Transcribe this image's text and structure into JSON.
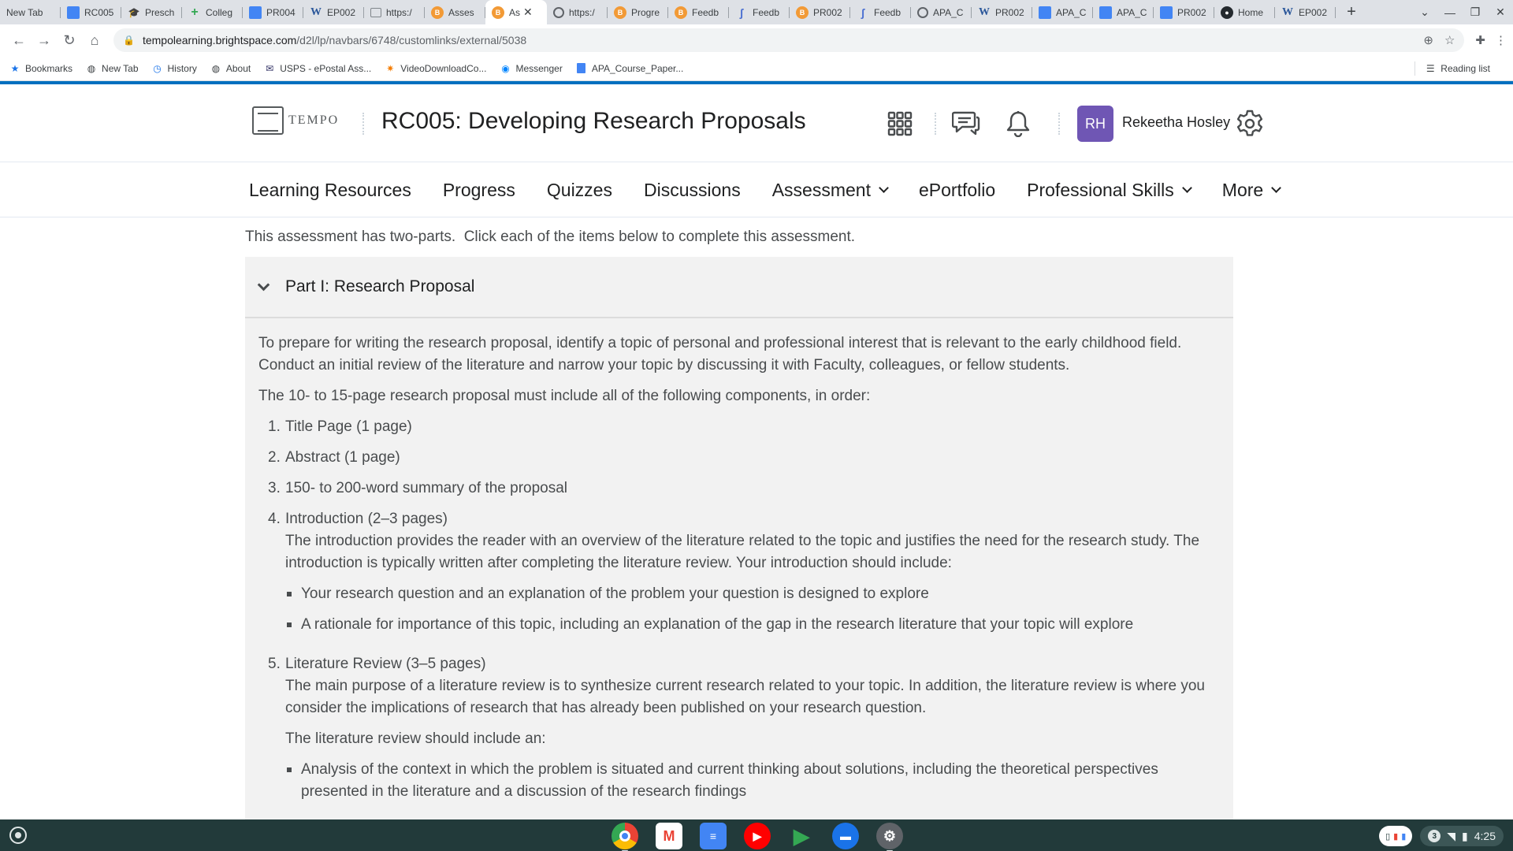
{
  "browser": {
    "tabs": [
      {
        "label": "New Tab",
        "icon": "none"
      },
      {
        "label": "RC005",
        "icon": "docs"
      },
      {
        "label": "Presch",
        "icon": "graduation-cap"
      },
      {
        "label": "Colleg",
        "icon": "plus"
      },
      {
        "label": "PR004",
        "icon": "docs"
      },
      {
        "label": "EP002",
        "icon": "word"
      },
      {
        "label": "https:/",
        "icon": "image"
      },
      {
        "label": "Asses",
        "icon": "d2l"
      },
      {
        "label": "As",
        "icon": "d2l",
        "active": true
      },
      {
        "label": "https:/",
        "icon": "globe"
      },
      {
        "label": "Progre",
        "icon": "d2l"
      },
      {
        "label": "Feedb",
        "icon": "d2l"
      },
      {
        "label": "Feedb",
        "icon": "feedback"
      },
      {
        "label": "PR002",
        "icon": "d2l"
      },
      {
        "label": "Feedb",
        "icon": "feedback"
      },
      {
        "label": "APA_C",
        "icon": "globe"
      },
      {
        "label": "PR002",
        "icon": "word"
      },
      {
        "label": "APA_C",
        "icon": "docs"
      },
      {
        "label": "APA_C",
        "icon": "docs"
      },
      {
        "label": "PR002",
        "icon": "docs"
      },
      {
        "label": "Home",
        "icon": "github"
      },
      {
        "label": "EP002",
        "icon": "word"
      }
    ],
    "url_host": "tempolearning.brightspace.com",
    "url_path": "/d2l/lp/navbars/6748/customlinks/external/5038",
    "bookmarks": [
      {
        "label": "Bookmarks",
        "icon": "star-icon"
      },
      {
        "label": "New Tab",
        "icon": "globe-icon"
      },
      {
        "label": "History",
        "icon": "history-icon"
      },
      {
        "label": "About",
        "icon": "globe-icon"
      },
      {
        "label": "USPS - ePostal Ass...",
        "icon": "usps-icon"
      },
      {
        "label": "VideoDownloadCo...",
        "icon": "spark-icon"
      },
      {
        "label": "Messenger",
        "icon": "messenger-icon"
      },
      {
        "label": "APA_Course_Paper...",
        "icon": "docs-icon"
      }
    ],
    "reading_list": "Reading list"
  },
  "header": {
    "logo_text": "TEMPO",
    "course_title": "RC005: Developing Research Proposals",
    "user_initials": "RH",
    "user_name": "Rekeetha Hosley"
  },
  "nav": [
    {
      "label": "Learning Resources",
      "dropdown": false
    },
    {
      "label": "Progress",
      "dropdown": false
    },
    {
      "label": "Quizzes",
      "dropdown": false
    },
    {
      "label": "Discussions",
      "dropdown": false
    },
    {
      "label": "Assessment",
      "dropdown": true
    },
    {
      "label": "ePortfolio",
      "dropdown": false
    },
    {
      "label": "Professional Skills",
      "dropdown": true
    },
    {
      "label": "More",
      "dropdown": true
    }
  ],
  "content": {
    "intro": "This assessment has two-parts.  Click each of the items below to complete this assessment.",
    "part1_title": "Part I: Research Proposal",
    "para1": "To prepare for writing the research proposal, identify a topic of personal and professional interest that is relevant to the early childhood field. Conduct an initial review of the literature and narrow your topic by discussing it with Faculty, colleagues, or fellow students.",
    "para2": "The 10- to 15-page research proposal must include all of the following components, in order:",
    "items": [
      {
        "num": "1.",
        "title": "Title Page (1 page)"
      },
      {
        "num": "2.",
        "title": "Abstract (1 page)"
      },
      {
        "num": "3.",
        "title": "150- to 200-word summary of the proposal"
      },
      {
        "num": "4.",
        "title": "Introduction (2–3 pages)",
        "desc": "The introduction provides the reader with an overview of the literature related to the topic and justifies the need for the research study. The introduction is typically written after completing the literature review. Your introduction should include:",
        "bullets": [
          "Your research question and an explanation of the problem your question is designed to explore",
          "A rationale for importance of this topic, including an explanation of the gap in the research literature that your topic will explore"
        ]
      },
      {
        "num": "5.",
        "title": "Literature Review (3–5 pages)",
        "desc": "The main purpose of a literature review is to synthesize current research related to your topic. In addition, the literature review is where you consider the implications of research that has already been published on your research question.",
        "desc2": "The literature review should include an:",
        "bullets": [
          "Analysis of the context in which the problem is situated and current thinking about solutions, including the theoretical perspectives presented in the literature and a discussion of the research findings"
        ]
      }
    ]
  },
  "shelf": {
    "apps": [
      "chrome-icon",
      "gmail-icon",
      "docs-icon",
      "youtube-icon",
      "play-store-icon",
      "messages-icon",
      "settings-icon"
    ],
    "notification_count": "3",
    "time": "4:25"
  },
  "colors": {
    "accent": "#006fbf",
    "avatar": "#6f56b4",
    "shelf": "#223a3a",
    "panel": "#f2f2f2"
  }
}
